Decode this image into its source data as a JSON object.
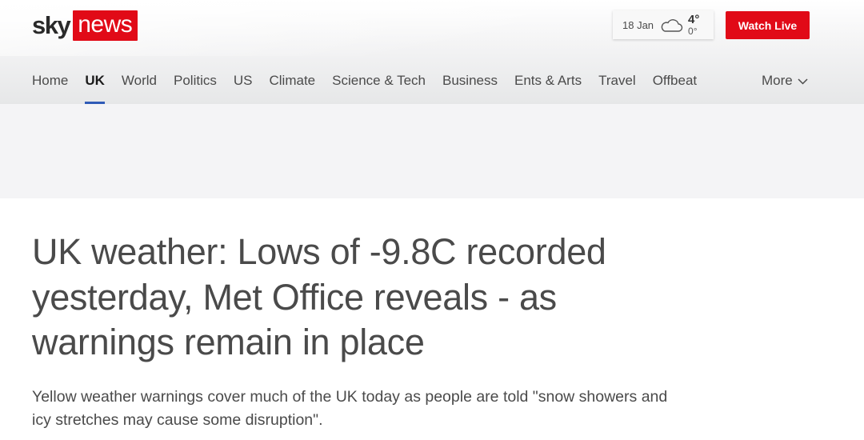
{
  "logo": {
    "sky": "sky",
    "news": "news"
  },
  "weather": {
    "date": "18 Jan",
    "icon": "cloud-icon",
    "high": "4°",
    "low": "0°"
  },
  "watch_live": "Watch Live",
  "nav": {
    "items": [
      {
        "label": "Home",
        "active": false
      },
      {
        "label": "UK",
        "active": true
      },
      {
        "label": "World",
        "active": false
      },
      {
        "label": "Politics",
        "active": false
      },
      {
        "label": "US",
        "active": false
      },
      {
        "label": "Climate",
        "active": false
      },
      {
        "label": "Science & Tech",
        "active": false
      },
      {
        "label": "Business",
        "active": false
      },
      {
        "label": "Ents & Arts",
        "active": false
      },
      {
        "label": "Travel",
        "active": false
      },
      {
        "label": "Offbeat",
        "active": false
      }
    ],
    "more": "More"
  },
  "article": {
    "headline": "UK weather: Lows of -9.8C recorded yesterday, Met Office reveals - as warnings remain in place",
    "standfirst": "Yellow weather warnings cover much of the UK today as people are told \"snow showers and icy stretches may cause some disruption\"."
  },
  "colors": {
    "brand_red": "#e10a17",
    "active_underline": "#2f5bb7"
  }
}
